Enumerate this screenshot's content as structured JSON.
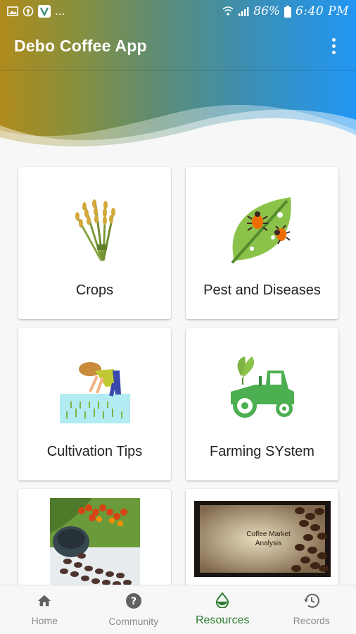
{
  "status_bar": {
    "left_icons": [
      "image-icon",
      "location-icon",
      "v-app-icon"
    ],
    "more": "...",
    "battery_pct": "86%",
    "time": "6:40 PM"
  },
  "app_bar": {
    "title": "Debo Coffee App",
    "menu_icon": "more-vert-icon"
  },
  "colors": {
    "gradient_start": "#b08b1d",
    "gradient_end": "#2196f3",
    "active_nav": "#2e7d32",
    "inactive_nav": "#8a8a8a"
  },
  "grid": {
    "items": [
      {
        "label": "Crops",
        "icon": "wheat-icon"
      },
      {
        "label": "Pest and Diseases",
        "icon": "leaf-bug-icon"
      },
      {
        "label": "Cultivation Tips",
        "icon": "farmer-planting-icon"
      },
      {
        "label": "Farming SYstem",
        "icon": "tractor-icon"
      },
      {
        "label": "",
        "icon": "coffee-beans-photo"
      },
      {
        "label": "",
        "icon": "coffee-market-photo",
        "photo_caption": "Coffee Market Analysis"
      }
    ]
  },
  "bottom_nav": {
    "items": [
      {
        "label": "Home",
        "icon": "home-icon",
        "active": false
      },
      {
        "label": "Community",
        "icon": "help-circle-icon",
        "active": false
      },
      {
        "label": "Resources",
        "icon": "water-drop-icon",
        "active": true
      },
      {
        "label": "Records",
        "icon": "history-icon",
        "active": false
      }
    ]
  }
}
